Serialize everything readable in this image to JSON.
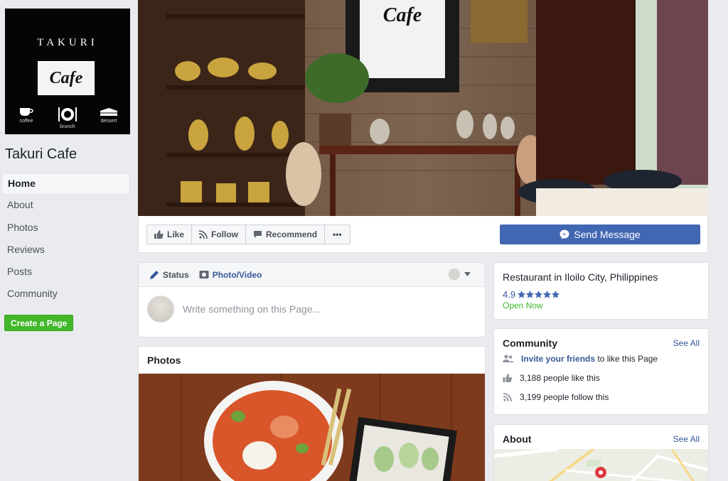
{
  "sidebar": {
    "logo": {
      "brand": "TAKURI",
      "cafe": "Cafe",
      "icons": [
        "coffee",
        "brunch",
        "dessert"
      ]
    },
    "page_name": "Takuri Cafe",
    "nav": [
      "Home",
      "About",
      "Photos",
      "Reviews",
      "Posts",
      "Community"
    ],
    "create_page": "Create a Page"
  },
  "actions": {
    "like": "Like",
    "follow": "Follow",
    "recommend": "Recommend",
    "more": "•••",
    "send_message": "Send Message"
  },
  "composer": {
    "status": "Status",
    "photo_video": "Photo/Video",
    "placeholder": "Write something on this Page..."
  },
  "photos": {
    "title": "Photos"
  },
  "info": {
    "category": "Restaurant in Iloilo City, Philippines",
    "rating": "4.9",
    "stars": 5,
    "open": "Open Now"
  },
  "community": {
    "title": "Community",
    "see_all": "See All",
    "invite_link": "Invite your friends",
    "invite_rest": "to like this Page",
    "likes": "3,188 people like this",
    "follows": "3,199 people follow this"
  },
  "about": {
    "title": "About",
    "see_all": "See All"
  },
  "colors": {
    "facebook_blue": "#4267b2",
    "link_blue": "#365899",
    "green": "#42b72a",
    "background": "#e9ebee"
  }
}
